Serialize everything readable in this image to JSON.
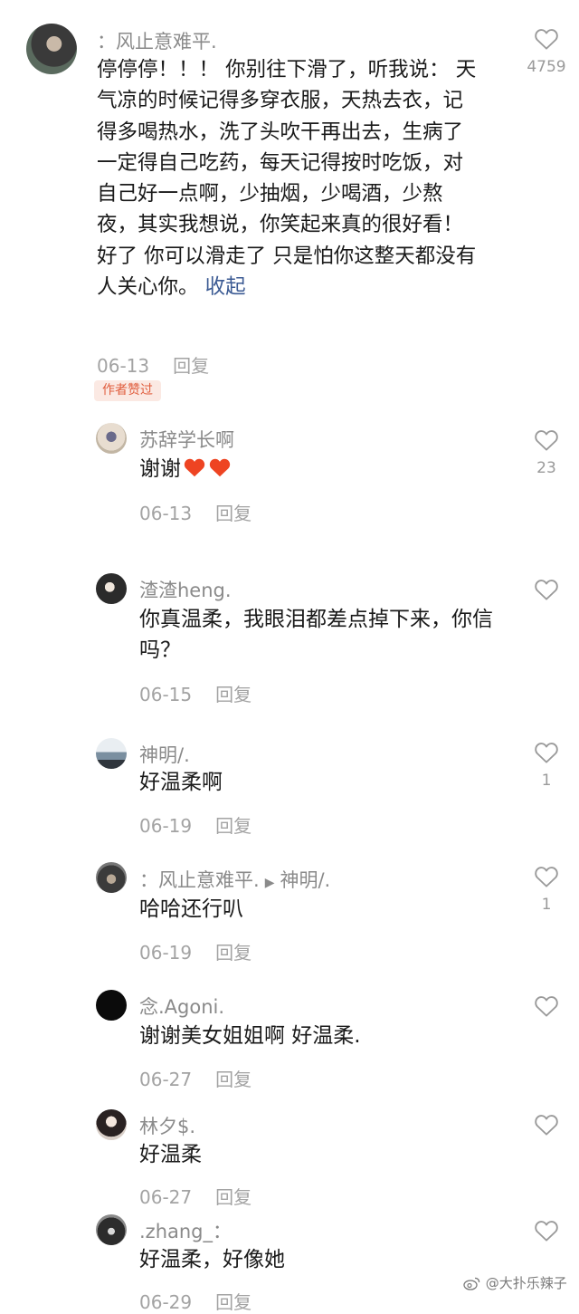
{
  "comments": [
    {
      "name": "：风止意难平.",
      "text": "停停停！！！ 你别往下滑了，听我说： 天气凉的时候记得多穿衣服，天热去衣，记得多喝热水，洗了头吹干再出去，生病了一定得自己吃药，每天记得按时吃饭，对自己好一点啊，少抽烟，少喝酒，少熬夜，其实我想说，你笑起来真的很好看！ 好了 你可以滑走了 只是怕你这整天都没有人关心你。",
      "collapse": "收起",
      "date": "06-13",
      "reply": "回复",
      "badge": "作者赞过",
      "likes": "4759"
    }
  ],
  "replies": [
    {
      "name": "苏辞学长啊",
      "text": "谢谢",
      "date": "06-13",
      "reply": "回复",
      "likes": "23"
    },
    {
      "name": "渣渣heng.",
      "text": "你真温柔，我眼泪都差点掉下来，你信吗？",
      "date": "06-15",
      "reply": "回复",
      "likes": ""
    },
    {
      "name": "神明/.",
      "text": "好温柔啊",
      "date": "06-19",
      "reply": "回复",
      "likes": "1"
    },
    {
      "name": "：风止意难平.",
      "reply_to": "神明/.",
      "text": "哈哈还行叭",
      "date": "06-19",
      "reply": "回复",
      "likes": "1"
    },
    {
      "name": "念.Agoni.",
      "text": "谢谢美女姐姐啊 好温柔.",
      "date": "06-27",
      "reply": "回复",
      "likes": ""
    },
    {
      "name": "林夕$.",
      "text": "好温柔",
      "date": "06-27",
      "reply": "回复",
      "likes": ""
    },
    {
      "name": ".zhang_：",
      "text": "好温柔，好像她",
      "date": "06-29",
      "reply": "回复",
      "likes": ""
    }
  ],
  "watermark": "@大扑乐辣子",
  "icons": {
    "like": "heart-outline-icon",
    "emoji": "red-heart-icon",
    "reply_arrow": "triangle-right-icon",
    "weibo": "weibo-logo-icon"
  },
  "colors": {
    "name": "#8a8a8a",
    "link": "#3b5a93",
    "badge_bg": "#fbe9e3",
    "badge_text": "#e05d3d"
  }
}
